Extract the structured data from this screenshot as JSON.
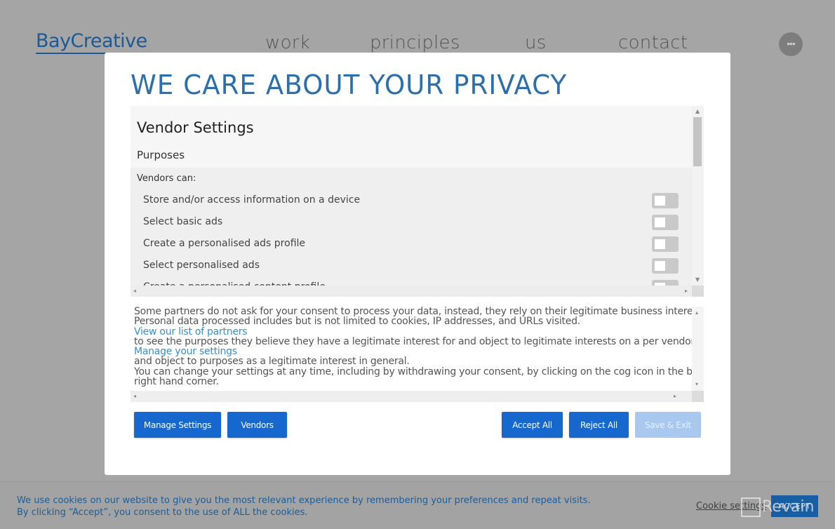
{
  "site": {
    "logo": "BayCreative",
    "nav": [
      "work",
      "principles",
      "us",
      "contact"
    ],
    "more_icon": "•••"
  },
  "modal": {
    "title": "WE CARE ABOUT YOUR PRIVACY",
    "vendor_settings": {
      "heading": "Vendor Settings",
      "subheading": "Purposes",
      "list_label": "Vendors can:",
      "purposes": [
        {
          "label": "Store and/or access information on a device",
          "enabled": false
        },
        {
          "label": "Select basic ads",
          "enabled": false
        },
        {
          "label": "Create a personalised ads profile",
          "enabled": false
        },
        {
          "label": "Select personalised ads",
          "enabled": false
        },
        {
          "label": "Create a personalised content profile",
          "enabled": false
        }
      ]
    },
    "info": {
      "line1": "Some partners do not ask for your consent to process your data, instead, they rely on their legitimate business interest.",
      "line2": "Personal data processed includes but is not limited to cookies, IP addresses, and URLs visited.",
      "link1": "View our list of partners",
      "line3": "to see the purposes they believe they have a legitimate interest for and object to legitimate interests on a per vendor basis.",
      "link2": "Manage your settings",
      "line4": "and object to purposes as a legitimate interest in general.",
      "line5": "You can change your settings at any time, including by withdrawing your consent, by clicking on the cog icon in the bottom",
      "line6": "right hand corner."
    },
    "buttons": {
      "manage": "Manage Settings",
      "vendors": "Vendors",
      "accept_all": "Accept All",
      "reject_all": "Reject All",
      "save_exit": "Save & Exit"
    },
    "colors": {
      "title": "#2c6fab",
      "button": "#1668cf",
      "button_disabled": "#a8c8ef",
      "link": "#3d8cc6"
    }
  },
  "cookie_bar": {
    "text": "We use cookies on our website to give you the most relevant experience by remembering your preferences and repeat visits. By clicking “Accept”, you consent to the use of ALL the cookies.",
    "settings_link": "Cookie settings",
    "accept": "ACCEPT"
  },
  "watermark": "Revain"
}
